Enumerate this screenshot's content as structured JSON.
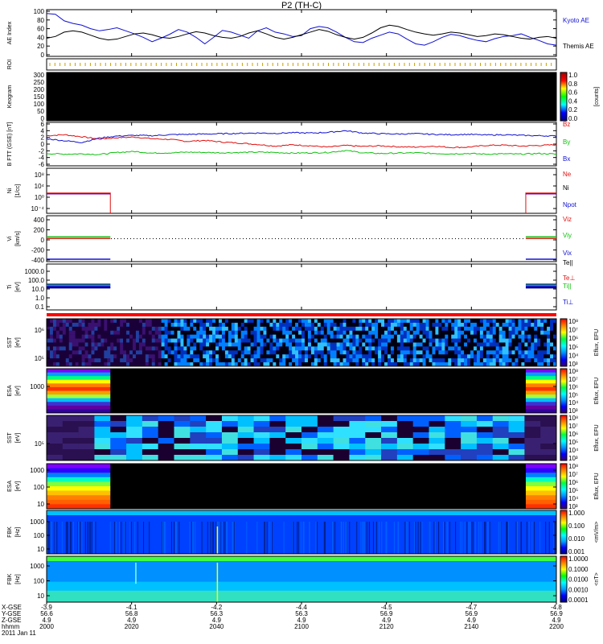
{
  "title": "P2 (TH-C)",
  "date_label": "2011 Jan 11",
  "colors": {
    "red": "#e01010",
    "green": "#10c010",
    "blue": "#1010d0",
    "purple": "#8000a0",
    "black": "#000000",
    "sep_red": "#ff0000"
  },
  "time_axis": {
    "start": "2000",
    "end": "2200",
    "row_labels": [
      "X-GSE",
      "Y-GSE",
      "Z-GSE",
      "hhmm"
    ],
    "ticks": [
      {
        "t": "2000",
        "xgse": "-3.9",
        "ygse": "56.6",
        "zgse": "4.9"
      },
      {
        "t": "2020",
        "xgse": "-4.1",
        "ygse": "56.8",
        "zgse": "4.9"
      },
      {
        "t": "2040",
        "xgse": "-4.2",
        "ygse": "56.3",
        "zgse": "4.9"
      },
      {
        "t": "2100",
        "xgse": "-4.4",
        "ygse": "56.3",
        "zgse": "4.9"
      },
      {
        "t": "2120",
        "xgse": "-4.5",
        "ygse": "56.9",
        "zgse": "4.9"
      },
      {
        "t": "2140",
        "xgse": "-4.7",
        "ygse": "56.9",
        "zgse": "4.9"
      },
      {
        "t": "2200",
        "xgse": "-4.8",
        "ygse": "56.9",
        "zgse": "4.9"
      }
    ]
  },
  "chart_data": [
    {
      "type": "line",
      "id": "ae",
      "ylabel": "AE Index",
      "yticks": [
        "100",
        "80",
        "60",
        "40",
        "20",
        "0"
      ],
      "ylim": [
        0,
        100
      ],
      "series": [
        {
          "name": "Kyoto AE",
          "color": "blue",
          "values": [
            95,
            93,
            78,
            72,
            68,
            60,
            55,
            58,
            62,
            55,
            48,
            40,
            30,
            38,
            47,
            58,
            52,
            40,
            25,
            40,
            56,
            52,
            45,
            38,
            55,
            62,
            52,
            48,
            42,
            44,
            60,
            65,
            62,
            52,
            40,
            30,
            28,
            38,
            45,
            52,
            48,
            36,
            25,
            22,
            30,
            40,
            47,
            44,
            38,
            33,
            30,
            37,
            42,
            44,
            48,
            40,
            33,
            25,
            22
          ]
        },
        {
          "name": "Themis AE",
          "color": "black",
          "values": [
            38,
            42,
            52,
            55,
            52,
            45,
            38,
            34,
            36,
            42,
            48,
            50,
            46,
            40,
            38,
            42,
            48,
            53,
            50,
            44,
            40,
            38,
            42,
            50,
            55,
            48,
            40,
            36,
            40,
            46,
            52,
            58,
            54,
            46,
            40,
            36,
            40,
            50,
            62,
            68,
            65,
            58,
            52,
            48,
            45,
            48,
            52,
            50,
            46,
            42,
            44,
            48,
            46,
            42,
            38,
            36,
            40,
            42,
            38
          ]
        }
      ]
    },
    {
      "type": "markers",
      "id": "roi",
      "ylabel": "ROI"
    },
    {
      "type": "heatmap",
      "id": "keogram",
      "ylabel": "Keogram",
      "yticks": [
        "300",
        "250",
        "200",
        "150",
        "100",
        "50",
        "0"
      ],
      "colorbar": {
        "label": "[counts]",
        "ticks": [
          "1.0",
          "0.8",
          "0.6",
          "0.4",
          "0.2",
          "0.0"
        ]
      }
    },
    {
      "type": "line",
      "id": "bfield",
      "ylabel": "B FTT (GSE) [nT]",
      "yticks": [
        "6",
        "4",
        "2",
        "0",
        "-2",
        "-4",
        "-6"
      ],
      "ylim": [
        -6,
        6
      ],
      "series": [
        {
          "name": "Bz",
          "color": "red",
          "values": [
            2.5,
            2.8,
            2.2,
            1.5,
            1.9,
            2.1,
            1.6,
            1.4,
            0.8,
            1.1,
            0.6,
            0.3,
            -0.1,
            -0.6,
            -0.2,
            -0.5,
            -0.9,
            -0.4,
            -0.7,
            -0.5,
            -0.8,
            -0.9,
            -0.6,
            -1.0,
            -0.9,
            -0.4,
            -0.3,
            -0.6,
            -0.4,
            -0.2
          ]
        },
        {
          "name": "By",
          "color": "green",
          "values": [
            -2.8,
            -3.0,
            -2.9,
            -3.1,
            -2.5,
            -2.2,
            -2.7,
            -2.6,
            -2.4,
            -2.5,
            -2.6,
            -2.5,
            -2.4,
            -2.5,
            -2.7,
            -2.6,
            -2.5,
            -1.9,
            -2.6,
            -2.8,
            -2.7,
            -2.6,
            -2.8,
            -2.9,
            -2.8,
            -3.0,
            -2.9,
            -3.0,
            -2.8,
            -3.0
          ]
        },
        {
          "name": "Bx",
          "color": "blue",
          "values": [
            1.6,
            1.0,
            0.5,
            1.8,
            2.4,
            2.6,
            2.5,
            2.8,
            2.9,
            3.0,
            3.1,
            3.2,
            3.3,
            3.2,
            3.4,
            3.3,
            3.5,
            4.0,
            3.3,
            3.1,
            3.0,
            3.1,
            2.9,
            2.8,
            2.9,
            2.7,
            2.8,
            2.6,
            2.5,
            2.4
          ]
        }
      ]
    },
    {
      "type": "line",
      "id": "density",
      "ylabel": "Ni",
      "units": "[1/cc]",
      "yticks": [
        "10⁸",
        "10⁴",
        "10⁰",
        "10⁻⁴"
      ],
      "series": [
        {
          "name": "Ne",
          "color": "red"
        },
        {
          "name": "Ni",
          "color": "black"
        },
        {
          "name": "Npot",
          "color": "blue"
        }
      ]
    },
    {
      "type": "line",
      "id": "velocity",
      "ylabel": "Vi",
      "units": "[km/s]",
      "yticks": [
        "400",
        "200",
        "0",
        "-200",
        "-400"
      ],
      "ylim": [
        -500,
        500
      ],
      "series": [
        {
          "name": "Viz",
          "color": "red"
        },
        {
          "name": "Viy",
          "color": "green"
        },
        {
          "name": "Vix",
          "color": "blue"
        }
      ]
    },
    {
      "type": "line",
      "id": "temperature",
      "ylabel": "Ti",
      "units": "[eV]",
      "yticks": [
        "1000.0",
        "100.0",
        "10.0",
        "1.0",
        "0.1"
      ],
      "series": [
        {
          "name": "Te||",
          "color": "black"
        },
        {
          "name": "Te⊥",
          "color": "red"
        },
        {
          "name": "Ti||",
          "color": "green"
        },
        {
          "name": "Ti⊥",
          "color": "blue"
        }
      ]
    },
    {
      "type": "heatmap",
      "id": "sst1",
      "ylabel": "SST",
      "units": "[eV]",
      "yticks": [
        "10⁶",
        "10⁵"
      ],
      "colorbar": {
        "label": "Eflux, EFU",
        "ticks": [
          "10⁸",
          "10⁷",
          "10⁶",
          "10⁵",
          "10⁴",
          "10³"
        ]
      }
    },
    {
      "type": "heatmap",
      "id": "esa1",
      "ylabel": "ESA",
      "units": "[eV]",
      "yticks": [
        "1000"
      ],
      "colorbar": {
        "label": "Eflux, EFU",
        "ticks": [
          "10⁸",
          "10⁷",
          "10⁶",
          "10⁵",
          "10⁴",
          "10³"
        ]
      }
    },
    {
      "type": "heatmap",
      "id": "sst2",
      "ylabel": "SST",
      "units": "[eV]",
      "yticks": [
        "10⁵"
      ],
      "colorbar": {
        "label": "Eflux, EFU",
        "ticks": [
          "10⁸",
          "10⁷",
          "10⁶",
          "10⁵",
          "10⁴",
          "10³"
        ]
      }
    },
    {
      "type": "heatmap",
      "id": "esa2",
      "ylabel": "ESA",
      "units": "[eV]",
      "yticks": [
        "1000",
        "100",
        "10"
      ],
      "colorbar": {
        "label": "Eflux, EFU",
        "ticks": [
          "10⁸",
          "10⁷",
          "10⁶",
          "10⁵",
          "10⁴",
          "10³"
        ]
      }
    },
    {
      "type": "heatmap",
      "id": "fbk1",
      "ylabel": "FBK",
      "units": "[Hz]",
      "yticks": [
        "1000",
        "100",
        "10"
      ],
      "colorbar": {
        "label": "<mV/m>",
        "ticks": [
          "1.000",
          "0.100",
          "0.010",
          "0.001"
        ]
      }
    },
    {
      "type": "heatmap",
      "id": "fbk2",
      "ylabel": "FBK",
      "units": "[Hz]",
      "yticks": [
        "1000",
        "100",
        "10"
      ],
      "colorbar": {
        "label": "<nT>",
        "ticks": [
          "1.0000",
          "0.1000",
          "0.0100",
          "0.0010",
          "0.0001"
        ]
      }
    }
  ]
}
